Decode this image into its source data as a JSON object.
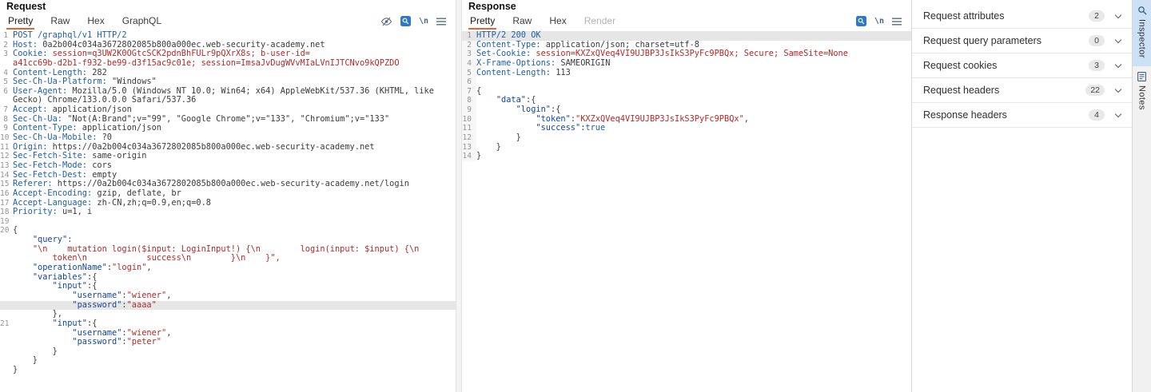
{
  "colors": {
    "accent_orange": "#e8622d",
    "inspector_tab_blue": "#cde1f6"
  },
  "glyphs": {
    "newline": "\\n"
  },
  "request": {
    "title": "Request",
    "tabs": [
      "Pretty",
      "Raw",
      "Hex",
      "GraphQL"
    ],
    "active_tab": "Pretty",
    "disabled_tabs": [],
    "icons": [
      "hide-matches-icon",
      "search-icon",
      "newline-toggle-icon",
      "editor-menu-icon"
    ],
    "lines": [
      {
        "n": "1",
        "s": [
          {
            "t": "POST /graphql/v1 HTTP/2",
            "c": "req"
          }
        ]
      },
      {
        "n": "2",
        "s": [
          {
            "t": "Host:",
            "c": "name"
          },
          {
            "t": " 0a2b004c034a3672802085b800a000ec.web-security-academy.net",
            "c": "p"
          }
        ]
      },
      {
        "n": "3",
        "s": [
          {
            "t": "Cookie:",
            "c": "name"
          },
          {
            "t": " ",
            "c": "p"
          },
          {
            "t": "session=q3UW2K0OGtcSCK2pdnBhFULr9pQXrX8s; b-user-id=",
            "c": "red"
          }
        ]
      },
      {
        "n": "",
        "s": [
          {
            "t": "a41cc69b-d2b1-f932-be99-d3f15ac9c01e; session=ImsaJvDugWVvMIaLVnIJTCNvo9kQPZDO",
            "c": "red"
          }
        ]
      },
      {
        "n": "4",
        "s": [
          {
            "t": "Content-Length:",
            "c": "name"
          },
          {
            "t": " 282",
            "c": "p"
          }
        ]
      },
      {
        "n": "5",
        "s": [
          {
            "t": "Sec-Ch-Ua-Platform:",
            "c": "name"
          },
          {
            "t": " \"Windows\"",
            "c": "p"
          }
        ]
      },
      {
        "n": "6",
        "s": [
          {
            "t": "User-Agent:",
            "c": "name"
          },
          {
            "t": " Mozilla/5.0 (Windows NT 10.0; Win64; x64) AppleWebKit/537.36 (KHTML, like",
            "c": "p"
          }
        ]
      },
      {
        "n": "",
        "s": [
          {
            "t": "Gecko) Chrome/133.0.0.0 Safari/537.36",
            "c": "p"
          }
        ]
      },
      {
        "n": "7",
        "s": [
          {
            "t": "Accept:",
            "c": "name"
          },
          {
            "t": " application/json",
            "c": "p"
          }
        ]
      },
      {
        "n": "8",
        "s": [
          {
            "t": "Sec-Ch-Ua:",
            "c": "name"
          },
          {
            "t": " \"Not(A:Brand\";v=\"99\", \"Google Chrome\";v=\"133\", \"Chromium\";v=\"133\"",
            "c": "p"
          }
        ]
      },
      {
        "n": "9",
        "s": [
          {
            "t": "Content-Type:",
            "c": "name"
          },
          {
            "t": " application/json",
            "c": "p"
          }
        ]
      },
      {
        "n": "10",
        "s": [
          {
            "t": "Sec-Ch-Ua-Mobile:",
            "c": "name"
          },
          {
            "t": " ?0",
            "c": "p"
          }
        ]
      },
      {
        "n": "11",
        "s": [
          {
            "t": "Origin:",
            "c": "name"
          },
          {
            "t": " https://0a2b004c034a3672802085b800a000ec.web-security-academy.net",
            "c": "p"
          }
        ]
      },
      {
        "n": "12",
        "s": [
          {
            "t": "Sec-Fetch-Site:",
            "c": "name"
          },
          {
            "t": " same-origin",
            "c": "p"
          }
        ]
      },
      {
        "n": "13",
        "s": [
          {
            "t": "Sec-Fetch-Mode:",
            "c": "name"
          },
          {
            "t": " cors",
            "c": "p"
          }
        ]
      },
      {
        "n": "14",
        "s": [
          {
            "t": "Sec-Fetch-Dest:",
            "c": "name"
          },
          {
            "t": " empty",
            "c": "p"
          }
        ]
      },
      {
        "n": "15",
        "s": [
          {
            "t": "Referer:",
            "c": "name"
          },
          {
            "t": " https://0a2b004c034a3672802085b800a000ec.web-security-academy.net/login",
            "c": "p"
          }
        ]
      },
      {
        "n": "16",
        "s": [
          {
            "t": "Accept-Encoding:",
            "c": "name"
          },
          {
            "t": " gzip, deflate, br",
            "c": "p"
          }
        ]
      },
      {
        "n": "17",
        "s": [
          {
            "t": "Accept-Language:",
            "c": "name"
          },
          {
            "t": " zh-CN,zh;q=0.9,en;q=0.8",
            "c": "p"
          }
        ]
      },
      {
        "n": "18",
        "s": [
          {
            "t": "Priority:",
            "c": "name"
          },
          {
            "t": " u=1, i",
            "c": "p"
          }
        ]
      },
      {
        "n": "19",
        "s": []
      },
      {
        "n": "20",
        "s": [
          {
            "t": "{",
            "c": "pu"
          }
        ]
      },
      {
        "n": "",
        "s": [
          {
            "t": "    ",
            "c": "p"
          },
          {
            "t": "\"query\":",
            "c": "key"
          }
        ]
      },
      {
        "n": "",
        "s": [
          {
            "t": "    ",
            "c": "p"
          },
          {
            "t": "\"\\n    mutation login($input: LoginInput!) {\\n        login(input: $input) {\\n",
            "c": "str"
          }
        ]
      },
      {
        "n": "",
        "s": [
          {
            "t": "        token\\n            success\\n        }\\n    }\",",
            "c": "str"
          }
        ]
      },
      {
        "n": "",
        "s": [
          {
            "t": "    ",
            "c": "p"
          },
          {
            "t": "\"operationName\"",
            "c": "key"
          },
          {
            "t": ":",
            "c": "pu"
          },
          {
            "t": "\"login\"",
            "c": "str"
          },
          {
            "t": ",",
            "c": "pu"
          }
        ]
      },
      {
        "n": "",
        "s": [
          {
            "t": "    ",
            "c": "p"
          },
          {
            "t": "\"variables\"",
            "c": "key"
          },
          {
            "t": ":{",
            "c": "pu"
          }
        ]
      },
      {
        "n": "",
        "s": [
          {
            "t": "        ",
            "c": "p"
          },
          {
            "t": "\"input\"",
            "c": "key"
          },
          {
            "t": ":{",
            "c": "pu"
          }
        ]
      },
      {
        "n": "",
        "s": [
          {
            "t": "            ",
            "c": "p"
          },
          {
            "t": "\"username\"",
            "c": "key"
          },
          {
            "t": ":",
            "c": "pu"
          },
          {
            "t": "\"wiener\"",
            "c": "str"
          },
          {
            "t": ",",
            "c": "pu"
          }
        ]
      },
      {
        "n": "",
        "hl": true,
        "s": [
          {
            "t": "            ",
            "c": "p"
          },
          {
            "t": "\"password\"",
            "c": "key"
          },
          {
            "t": ":",
            "c": "pu"
          },
          {
            "t": "\"aaaa\"",
            "c": "str"
          }
        ]
      },
      {
        "n": "",
        "s": [
          {
            "t": "        },",
            "c": "pu"
          }
        ]
      },
      {
        "n": "21",
        "s": [
          {
            "t": "        ",
            "c": "p"
          },
          {
            "t": "\"input\"",
            "c": "key"
          },
          {
            "t": ":{",
            "c": "pu"
          }
        ]
      },
      {
        "n": "",
        "s": [
          {
            "t": "            ",
            "c": "p"
          },
          {
            "t": "\"username\"",
            "c": "key"
          },
          {
            "t": ":",
            "c": "pu"
          },
          {
            "t": "\"wiener\"",
            "c": "str"
          },
          {
            "t": ",",
            "c": "pu"
          }
        ]
      },
      {
        "n": "",
        "s": [
          {
            "t": "            ",
            "c": "p"
          },
          {
            "t": "\"password\"",
            "c": "key"
          },
          {
            "t": ":",
            "c": "pu"
          },
          {
            "t": "\"peter\"",
            "c": "str"
          }
        ]
      },
      {
        "n": "",
        "s": [
          {
            "t": "        }",
            "c": "pu"
          }
        ]
      },
      {
        "n": "",
        "s": [
          {
            "t": "    }",
            "c": "pu"
          }
        ]
      },
      {
        "n": "",
        "s": [
          {
            "t": "}",
            "c": "pu"
          }
        ]
      }
    ]
  },
  "response": {
    "title": "Response",
    "tabs": [
      "Pretty",
      "Raw",
      "Hex",
      "Render"
    ],
    "active_tab": "Pretty",
    "disabled_tabs": [
      "Render"
    ],
    "icons": [
      "search-icon",
      "newline-toggle-icon",
      "editor-menu-icon"
    ],
    "lines": [
      {
        "n": "1",
        "hl": true,
        "s": [
          {
            "t": "HTTP/2 200 OK",
            "c": "req"
          }
        ]
      },
      {
        "n": "2",
        "s": [
          {
            "t": "Content-Type:",
            "c": "name"
          },
          {
            "t": " application/json; charset=utf-8",
            "c": "p"
          }
        ]
      },
      {
        "n": "3",
        "s": [
          {
            "t": "Set-Cookie:",
            "c": "name"
          },
          {
            "t": " ",
            "c": "p"
          },
          {
            "t": "session=KXZxQVeq4VI9UJBP3JsIkS3PyFc9PBQx; Secure; SameSite=None",
            "c": "red"
          }
        ]
      },
      {
        "n": "4",
        "s": [
          {
            "t": "X-Frame-Options:",
            "c": "name"
          },
          {
            "t": " SAMEORIGIN",
            "c": "p"
          }
        ]
      },
      {
        "n": "5",
        "s": [
          {
            "t": "Content-Length:",
            "c": "name"
          },
          {
            "t": " 113",
            "c": "p"
          }
        ]
      },
      {
        "n": "6",
        "s": []
      },
      {
        "n": "7",
        "s": [
          {
            "t": "{",
            "c": "pu"
          }
        ]
      },
      {
        "n": "8",
        "s": [
          {
            "t": "    ",
            "c": "p"
          },
          {
            "t": "\"data\"",
            "c": "key"
          },
          {
            "t": ":{",
            "c": "pu"
          }
        ]
      },
      {
        "n": "9",
        "s": [
          {
            "t": "        ",
            "c": "p"
          },
          {
            "t": "\"login\"",
            "c": "key"
          },
          {
            "t": ":{",
            "c": "pu"
          }
        ]
      },
      {
        "n": "10",
        "s": [
          {
            "t": "            ",
            "c": "p"
          },
          {
            "t": "\"token\"",
            "c": "key"
          },
          {
            "t": ":",
            "c": "pu"
          },
          {
            "t": "\"KXZxQVeq4VI9UJBP3JsIkS3PyFc9PBQx\"",
            "c": "str"
          },
          {
            "t": ",",
            "c": "pu"
          }
        ]
      },
      {
        "n": "11",
        "s": [
          {
            "t": "            ",
            "c": "p"
          },
          {
            "t": "\"success\"",
            "c": "key"
          },
          {
            "t": ":",
            "c": "pu"
          },
          {
            "t": "true",
            "c": "kw"
          }
        ]
      },
      {
        "n": "12",
        "s": [
          {
            "t": "        }",
            "c": "pu"
          }
        ]
      },
      {
        "n": "13",
        "s": [
          {
            "t": "    }",
            "c": "pu"
          }
        ]
      },
      {
        "n": "14",
        "s": [
          {
            "t": "}",
            "c": "pu"
          }
        ]
      }
    ]
  },
  "inspector": {
    "sections": [
      {
        "label": "Request attributes",
        "count": "2"
      },
      {
        "label": "Request query parameters",
        "count": "0"
      },
      {
        "label": "Request cookies",
        "count": "3"
      },
      {
        "label": "Request headers",
        "count": "22"
      },
      {
        "label": "Response headers",
        "count": "4"
      }
    ],
    "side_tabs": [
      {
        "label": "Inspector",
        "selected": true
      },
      {
        "label": "Notes",
        "selected": false
      }
    ]
  }
}
